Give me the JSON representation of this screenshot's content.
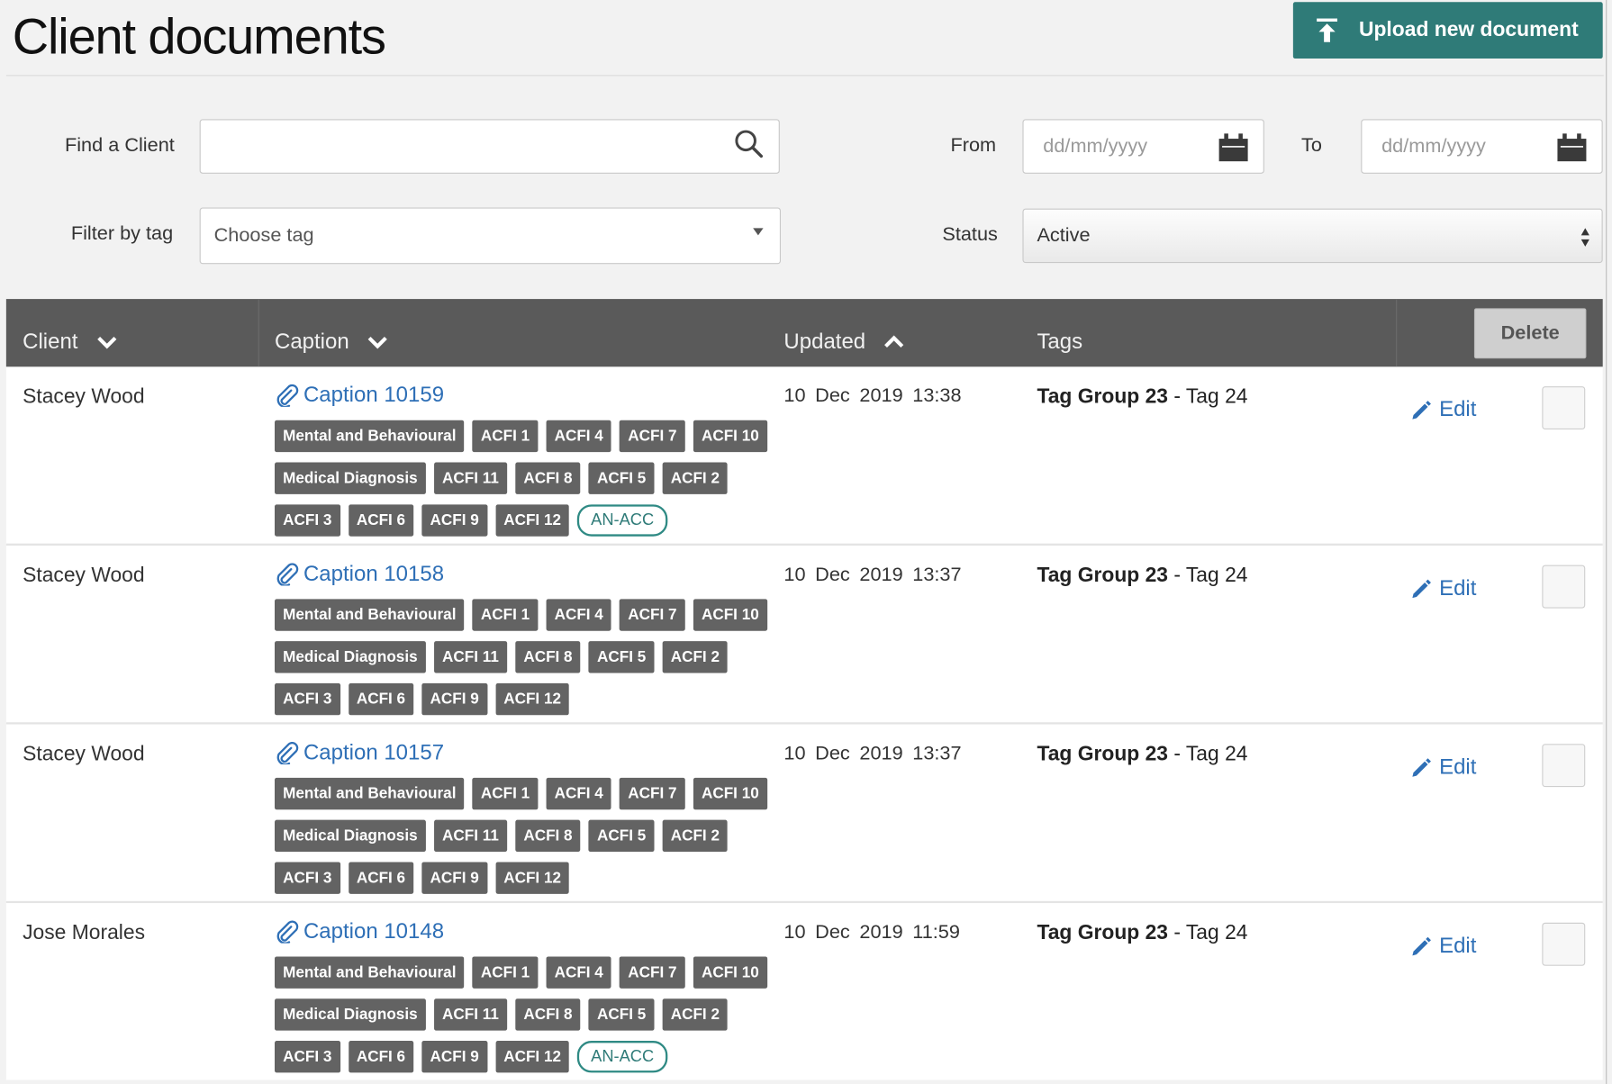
{
  "page": {
    "title": "Client documents",
    "upload_label": "Upload new document"
  },
  "filters": {
    "find_client_label": "Find a Client",
    "find_client_value": "",
    "from_label": "From",
    "to_label": "To",
    "date_placeholder": "dd/mm/yyyy",
    "filter_tag_label": "Filter by tag",
    "tag_placeholder": "Choose tag",
    "status_label": "Status",
    "status_value": "Active"
  },
  "table": {
    "columns": {
      "client": "Client",
      "caption": "Caption",
      "updated": "Updated",
      "tags": "Tags"
    },
    "delete_label": "Delete",
    "edit_label": "Edit",
    "rows": [
      {
        "client": "Stacey Wood",
        "caption": "Caption 10159",
        "updated": "10 Dec 2019 13:38",
        "tag_group": "Tag Group 23",
        "tag_name": " - Tag 24",
        "tags": [
          "Mental and Behavioural",
          "ACFI 1",
          "ACFI 4",
          "ACFI 7",
          "ACFI 10",
          "Medical Diagnosis",
          "ACFI 11",
          "ACFI 8",
          "ACFI 5",
          "ACFI 2",
          "ACFI 3",
          "ACFI 6",
          "ACFI 9",
          "ACFI 12"
        ],
        "extra_tag": "AN-ACC"
      },
      {
        "client": "Stacey Wood",
        "caption": "Caption 10158",
        "updated": "10 Dec 2019 13:37",
        "tag_group": "Tag Group 23",
        "tag_name": " - Tag 24",
        "tags": [
          "Mental and Behavioural",
          "ACFI 1",
          "ACFI 4",
          "ACFI 7",
          "ACFI 10",
          "Medical Diagnosis",
          "ACFI 11",
          "ACFI 8",
          "ACFI 5",
          "ACFI 2",
          "ACFI 3",
          "ACFI 6",
          "ACFI 9",
          "ACFI 12"
        ],
        "extra_tag": ""
      },
      {
        "client": "Stacey Wood",
        "caption": "Caption 10157",
        "updated": "10 Dec 2019 13:37",
        "tag_group": "Tag Group 23",
        "tag_name": " - Tag 24",
        "tags": [
          "Mental and Behavioural",
          "ACFI 1",
          "ACFI 4",
          "ACFI 7",
          "ACFI 10",
          "Medical Diagnosis",
          "ACFI 11",
          "ACFI 8",
          "ACFI 5",
          "ACFI 2",
          "ACFI 3",
          "ACFI 6",
          "ACFI 9",
          "ACFI 12"
        ],
        "extra_tag": ""
      },
      {
        "client": "Jose Morales",
        "caption": "Caption 10148",
        "updated": "10 Dec 2019 11:59",
        "tag_group": "Tag Group 23",
        "tag_name": " - Tag 24",
        "tags": [
          "Mental and Behavioural",
          "ACFI 1",
          "ACFI 4",
          "ACFI 7",
          "ACFI 10",
          "Medical Diagnosis",
          "ACFI 11",
          "ACFI 8",
          "ACFI 5",
          "ACFI 2",
          "ACFI 3",
          "ACFI 6",
          "ACFI 9",
          "ACFI 12"
        ],
        "extra_tag": "AN-ACC"
      }
    ]
  },
  "colors": {
    "brand": "#2f7b78",
    "link": "#2e6fb6",
    "header_bg": "#5a5a5a",
    "tag_bg": "#636363"
  },
  "icons": {
    "upload": "upload-icon",
    "search": "search-icon",
    "calendar": "calendar-icon",
    "attachment": "paperclip-icon",
    "edit": "pencil-icon",
    "sort_down": "chevron-down-icon",
    "sort_up": "chevron-up-icon"
  }
}
